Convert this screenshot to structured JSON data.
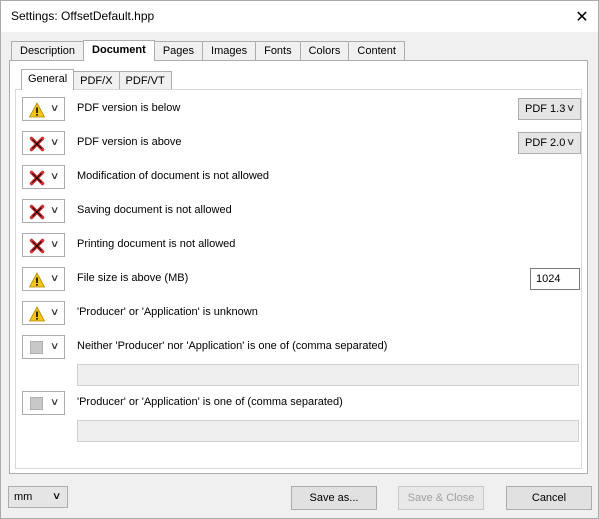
{
  "window": {
    "title": "Settings:  OffsetDefault.hpp"
  },
  "main_tabs": [
    "Description",
    "Document",
    "Pages",
    "Images",
    "Fonts",
    "Colors",
    "Content"
  ],
  "active_main_tab": "Document",
  "sub_tabs": [
    "General",
    "PDF/X",
    "PDF/VT"
  ],
  "active_sub_tab": "General",
  "rules": [
    {
      "severity": "warning",
      "label": "PDF version is below",
      "dropdown": "PDF 1.3"
    },
    {
      "severity": "error",
      "label": "PDF version is above",
      "dropdown": "PDF 2.0"
    },
    {
      "severity": "error",
      "label": "Modification of document is not allowed"
    },
    {
      "severity": "error",
      "label": "Saving document is not allowed"
    },
    {
      "severity": "error",
      "label": "Printing document is not allowed"
    },
    {
      "severity": "warning",
      "label": "File size is above (MB)",
      "input": "1024"
    },
    {
      "severity": "warning",
      "label": "'Producer' or 'Application' is unknown"
    },
    {
      "severity": "none",
      "label": "Neither 'Producer' nor 'Application' is one of (comma separated)",
      "text_value": ""
    },
    {
      "severity": "none",
      "label": "'Producer' or 'Application' is one of (comma separated)",
      "text_value": ""
    }
  ],
  "footer": {
    "unit": "mm",
    "save_as": "Save as...",
    "save_close": "Save & Close",
    "cancel": "Cancel"
  },
  "icons": {
    "warning": "warning-triangle-icon",
    "error": "error-x-icon",
    "none": "disabled-square-icon",
    "close": "close-icon"
  },
  "colors": {
    "warning": "#f5c518",
    "error": "#d32f2f"
  }
}
